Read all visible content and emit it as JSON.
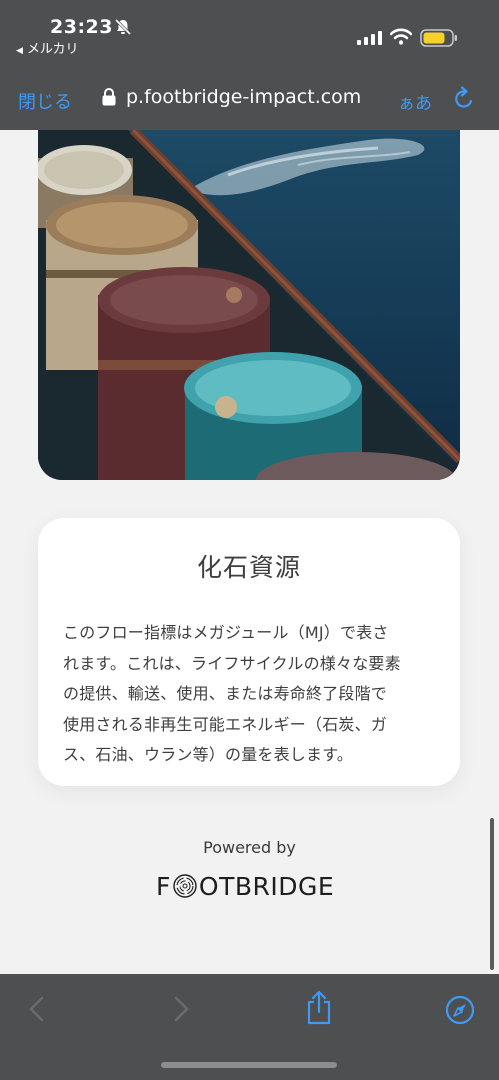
{
  "status_bar": {
    "time": "23:23",
    "back_app": "メルカリ",
    "battery_color": "#f5d22b"
  },
  "browser": {
    "close_label": "閉じる",
    "url": "p.footbridge-impact.com",
    "reader_label": "ぁあ",
    "accent_color": "#3e9af5"
  },
  "hero": {
    "icon": "oil-barrels-photo"
  },
  "card": {
    "title": "化石資源",
    "lines": [
      "このフロー指標はメガジュール（MJ）で表さ",
      "れます。これは、ライフサイクルの様々な要素",
      "の提供、輸送、使用、または寿命終了段階で",
      "使用される非再生可能エネルギー（石炭、ガ",
      "ス、石油、ウラン等）の量を表します。"
    ]
  },
  "footer": {
    "powered_by": "Powered by",
    "logo_f": "F",
    "logo_rest": "OTBRIDGE"
  },
  "toolbar": {
    "back_icon": "chevron-left-icon",
    "forward_icon": "chevron-right-icon",
    "share_icon": "share-icon",
    "compass_icon": "compass-icon"
  }
}
